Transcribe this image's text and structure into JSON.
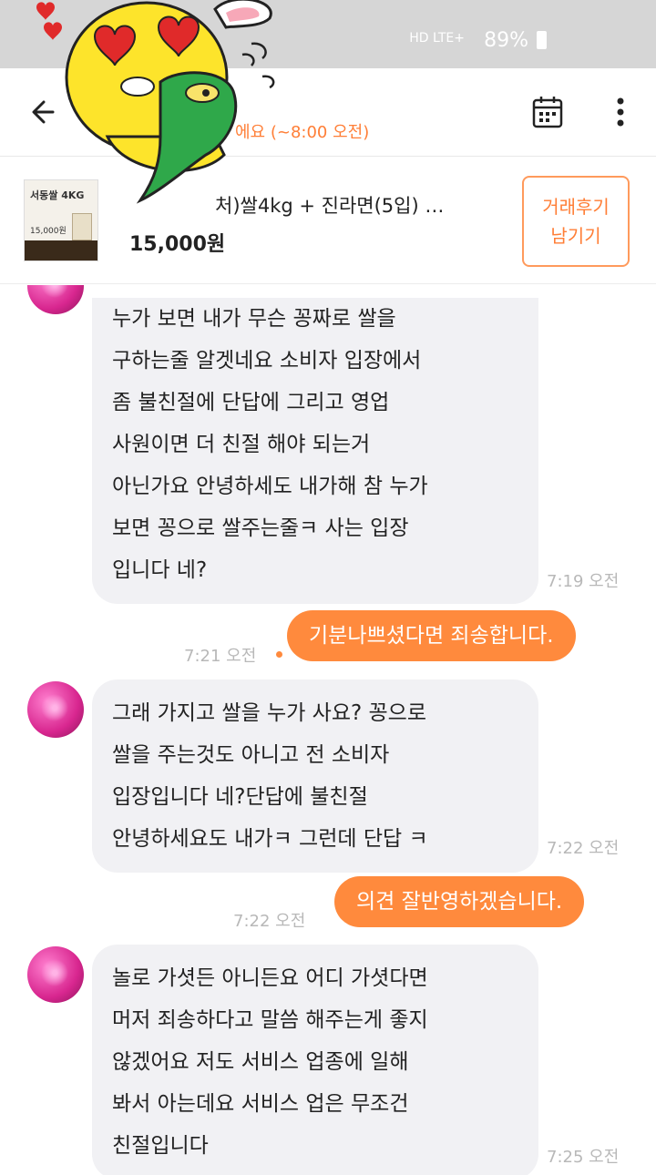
{
  "status_bar": {
    "network": "HD LTE+",
    "battery": "89%"
  },
  "header": {
    "subtitle": "에요 (~8:00 오전)"
  },
  "product": {
    "name": "처)쌀4kg + 진라면(5입) …",
    "price": "15,000원",
    "thumb_title": "서동쌀 4KG",
    "thumb_price": "15,000원",
    "review_button": "거래후기\n남기기"
  },
  "messages": [
    {
      "type": "in",
      "text": "누가 보면 내가 무슨 꽁짜로 쌀을\n구하는줄 알겟네요 소비자 입장에서\n좀 불친절에 단답에 그리고 영업\n사원이면 더 친절 해야 되는거\n아닌가요 안녕하세도 내가해 참 누가\n보면 꽁으로 쌀주는줄ㅋ  사는 입장\n입니다 네?",
      "time": "7:19 오전"
    },
    {
      "type": "out",
      "text": "기분나쁘셨다면 죄송합니다.",
      "time": "7:21 오전"
    },
    {
      "type": "in",
      "text": "그래 가지고 쌀을 누가 사요? 꽁으로\n쌀을 주는것도 아니고 전 소비자\n입장입니다 네?단답에 불친절\n안녕하세요도 내가ㅋ 그런데 단답 ㅋ",
      "time": "7:22 오전"
    },
    {
      "type": "out",
      "text": "의견 잘반영하겠습니다.",
      "time": "7:22 오전"
    },
    {
      "type": "in",
      "text": "놀로 가셧든 아니든요 어디 가셧다면\n머저 죄송하다고 말씀 해주는게 좋지\n않겠어요 저도 서비스 업종에 일해\n봐서 아는데요 서비스 업은 무조건\n친절입니다",
      "time": "7:25 오전"
    }
  ]
}
